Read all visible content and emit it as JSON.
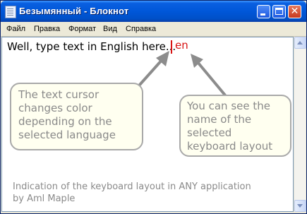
{
  "window": {
    "title": "Безымянный - Блокнот",
    "icon": "notepad-icon"
  },
  "title_buttons": {
    "minimize": "minimize-icon",
    "maximize": "maximize-icon",
    "close": "close-icon",
    "close_glyph": "✕"
  },
  "menu": {
    "file": "Файл",
    "edit": "Правка",
    "format": "Формат",
    "view": "Вид",
    "help": "Справка"
  },
  "editor": {
    "text": "Well, type text in English here...",
    "layout_indicator": "en",
    "caret_color": "#d81414"
  },
  "callouts": {
    "left_text": "The text cursor changes color depending on the selected language",
    "right_text": "You can see the name of the selected keyboard layout"
  },
  "caption": {
    "line1": "Indication of the keyboard layout in ANY application",
    "line2": "by Aml Maple"
  },
  "colors": {
    "accent": "#d81414",
    "callout_text": "#8a8a8a",
    "titlebar": "#0057d9"
  }
}
